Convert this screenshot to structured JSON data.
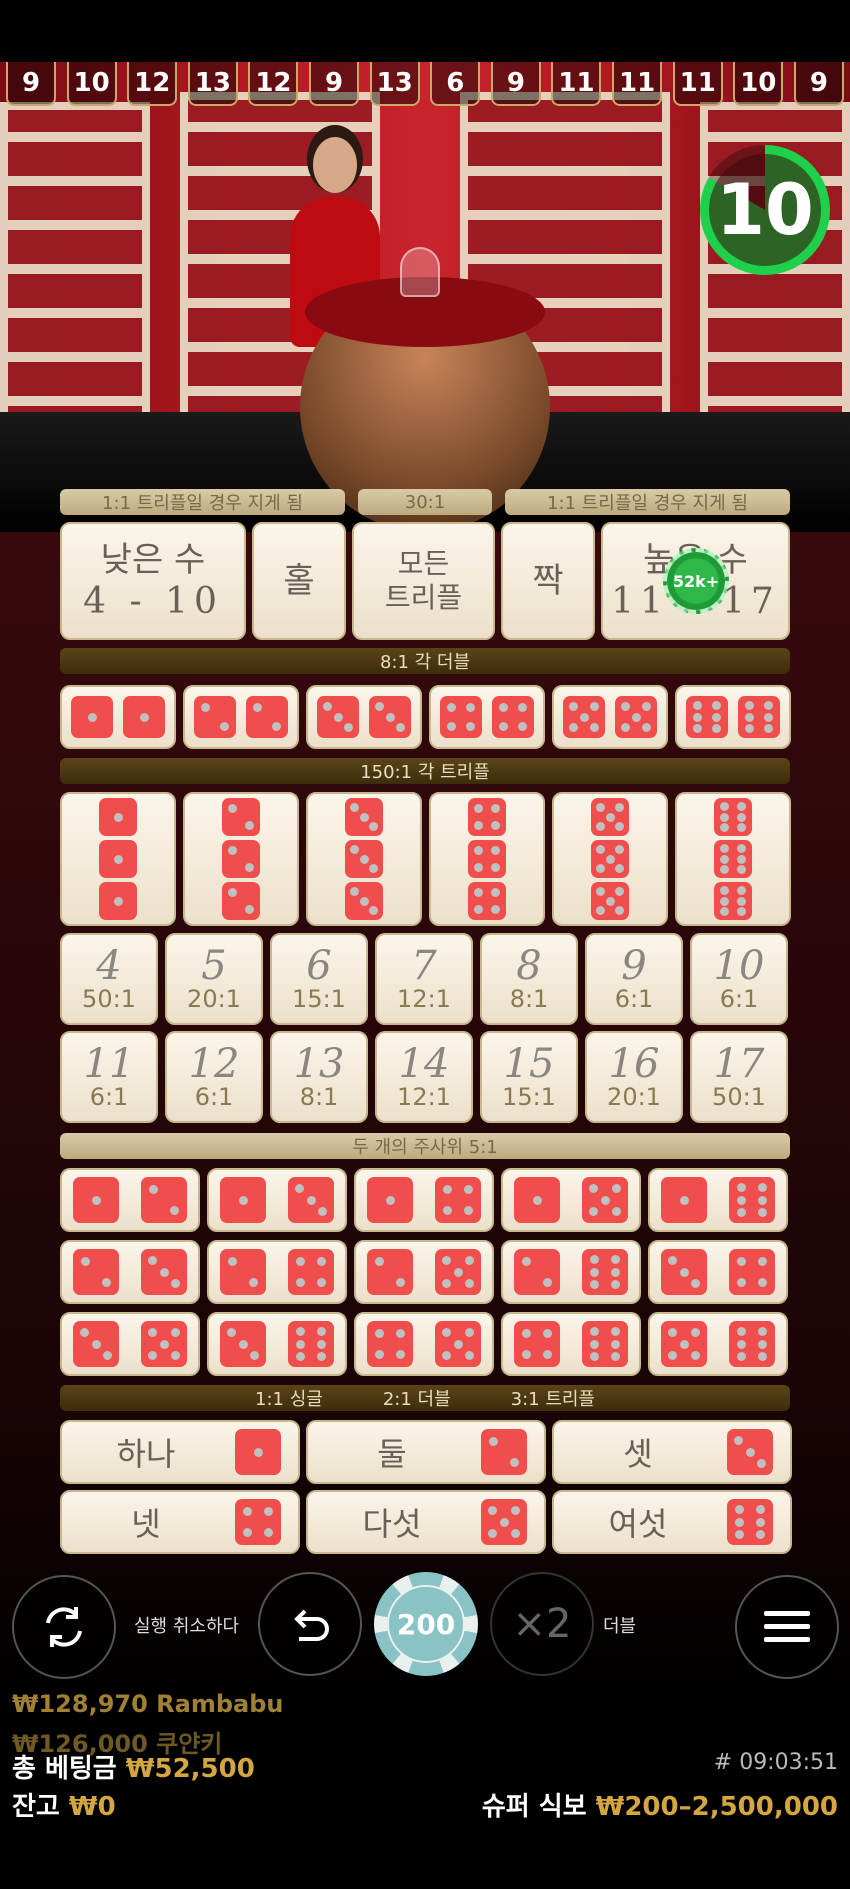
{
  "history": [
    "9",
    "10",
    "12",
    "13",
    "12",
    "9",
    "13",
    "6",
    "9",
    "11",
    "11",
    "11",
    "10",
    "9"
  ],
  "timer": "10",
  "labels": {
    "low_payout": "1:1 트리플일 경우 지게 됨",
    "any_triple_payout": "30:1",
    "high_payout": "1:1 트리플일 경우 지게 됨",
    "doubles_header": "8:1 각 더블",
    "triples_header": "150:1 각 트리플",
    "two_dice_header": "두 개의 주사위 5:1",
    "single_header_a": "1:1 싱글",
    "single_header_b": "2:1 더블",
    "single_header_c": "3:1 트리플"
  },
  "top_bets": {
    "low": "낮은 수",
    "low_range": "4 - 10",
    "odd": "홀",
    "any_triple": "모든\n트리플",
    "even": "짝",
    "high": "높은 수",
    "high_range": "11 - 17",
    "chip_amount": "52k+"
  },
  "totals": [
    {
      "num": "4",
      "odds": "50:1"
    },
    {
      "num": "5",
      "odds": "20:1"
    },
    {
      "num": "6",
      "odds": "15:1"
    },
    {
      "num": "7",
      "odds": "12:1"
    },
    {
      "num": "8",
      "odds": "8:1"
    },
    {
      "num": "9",
      "odds": "6:1"
    },
    {
      "num": "10",
      "odds": "6:1"
    },
    {
      "num": "11",
      "odds": "6:1"
    },
    {
      "num": "12",
      "odds": "6:1"
    },
    {
      "num": "13",
      "odds": "8:1"
    },
    {
      "num": "14",
      "odds": "12:1"
    },
    {
      "num": "15",
      "odds": "15:1"
    },
    {
      "num": "16",
      "odds": "20:1"
    },
    {
      "num": "17",
      "odds": "50:1"
    }
  ],
  "singles": [
    "하나",
    "둘",
    "셋",
    "넷",
    "다섯",
    "여섯"
  ],
  "controls": {
    "repeat_label": "실행 취소하다",
    "chip_value": "200",
    "double_icon": "×2",
    "double_label": "더블"
  },
  "winners": [
    "₩128,970 Rambabu",
    "₩126,000 쿠얀키"
  ],
  "footer": {
    "total_bet_label": "총 베팅금",
    "total_bet": "₩52,500",
    "balance_label": "잔고",
    "balance": "₩0",
    "round_id": "# 09:03:51",
    "game_name": "슈퍼 식보",
    "limits": "₩200–2,500,000"
  },
  "colors": {
    "dice": "#ef4e4c",
    "accent": "#d4a640",
    "timer": "#1ed04a"
  }
}
